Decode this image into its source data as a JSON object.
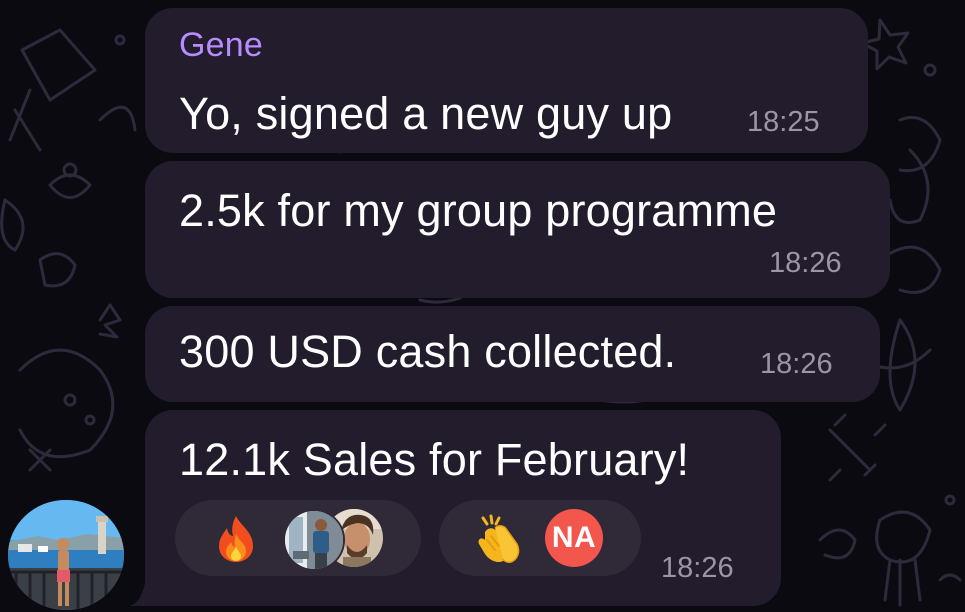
{
  "messages": [
    {
      "sender": "Gene",
      "text": "Yo, signed a new guy up",
      "time": "18:25"
    },
    {
      "text": "2.5k for my group programme",
      "time": "18:26"
    },
    {
      "text": "300 USD cash collected.",
      "time": "18:26"
    },
    {
      "text": "12.1k Sales for February!",
      "time": "18:26"
    }
  ],
  "reactions": [
    {
      "emoji": "fire-icon",
      "reactors": [
        "photo",
        "photo"
      ]
    },
    {
      "emoji": "clapping-hands-icon",
      "reactors": [
        "NA"
      ]
    }
  ],
  "colors": {
    "background": "#0b0a10",
    "bubble": "#221c2c",
    "sender_name": "#b88cff",
    "time": "#9c95a8",
    "reaction_pill": "#2f2938",
    "avatar_na": "#f2564d"
  }
}
